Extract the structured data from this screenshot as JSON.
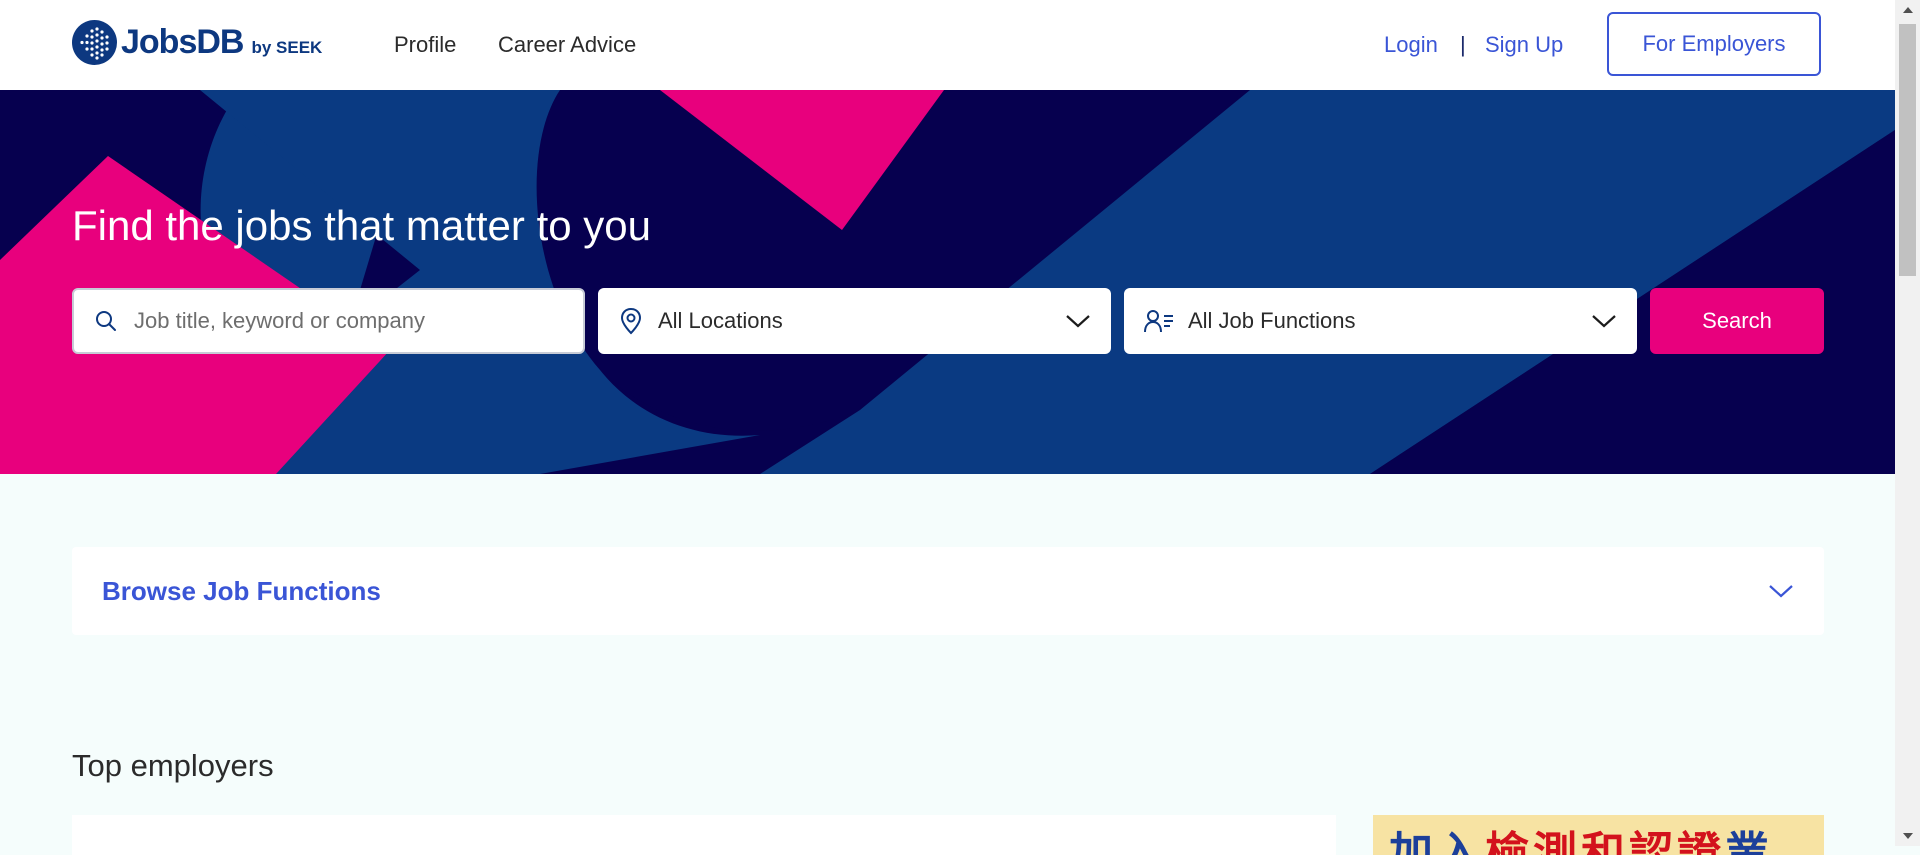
{
  "header": {
    "logo": {
      "name": "JobsDB",
      "suffix": "by SEEK"
    },
    "nav": [
      {
        "label": "Profile"
      },
      {
        "label": "Career Advice"
      }
    ],
    "auth": {
      "login": "Login",
      "separator": "|",
      "signup": "Sign Up"
    },
    "employers_button": "For Employers"
  },
  "hero": {
    "title": "Find the jobs that matter to you",
    "keyword_placeholder": "Job title, keyword or company",
    "location_value": "All Locations",
    "function_value": "All Job Functions",
    "search_label": "Search",
    "icons": {
      "keyword": "search-icon",
      "location": "location-pin-icon",
      "function": "job-function-icon",
      "dropdown": "chevron-down-icon"
    }
  },
  "browse": {
    "title": "Browse Job Functions",
    "icon": "chevron-down-icon"
  },
  "top_employers": {
    "title": "Top employers"
  },
  "ad": {
    "text_blue_1": "加入",
    "text_red": "檢測和認證",
    "text_blue_2": "業"
  },
  "colors": {
    "brand_navy": "#0d3880",
    "link_blue": "#3a55d6",
    "accent_pink": "#e8007d",
    "hero_dark": "#06004f",
    "hero_blue": "#0a3a82",
    "page_background": "#f5fdfc"
  }
}
